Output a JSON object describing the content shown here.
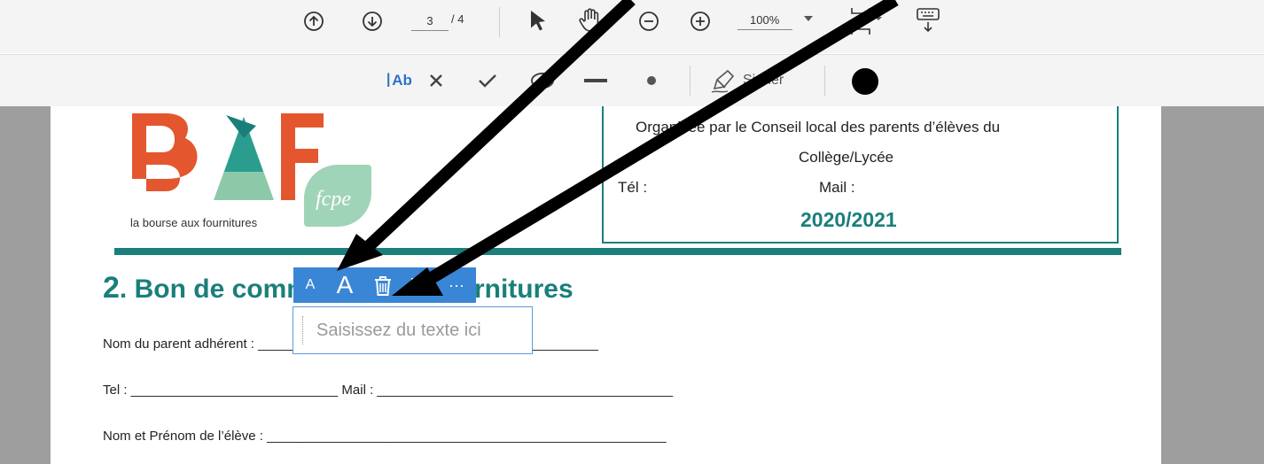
{
  "top_toolbar": {
    "current_page": "3",
    "page_total": "/ 4",
    "zoom": "100%"
  },
  "annotation_toolbar": {
    "text_tool_label": "Ab",
    "sign_label": "Signer",
    "color_swatch": "#000000"
  },
  "document": {
    "logo": {
      "tagline": "la bourse aux fournitures",
      "fcpe_text": "fcpe"
    },
    "organizer": {
      "line1": "Organisée par le Conseil local des parents d’élèves du",
      "line2": "Collège/Lycée",
      "tel_label": "Tél :",
      "mail_label": "Mail :",
      "year": "2020/2021"
    },
    "section": {
      "number": "2",
      "title": ". Bon de commande aux fournitures"
    },
    "fields": {
      "parent_name": "Nom du parent adhérent : ______________________________________________",
      "tel_mail": "Tel : ____________________________ Mail : ________________________________________",
      "student_name": "Nom et Prénom de l’élève : ______________________________________________________"
    }
  },
  "text_tool_popup": {
    "small_a": "A",
    "large_a": "A",
    "more": "···",
    "placeholder": "Saisissez du texte ici"
  },
  "colors": {
    "teal": "#1a7f7a",
    "logo_orange": "#e4572e",
    "fcpe_green": "#8cc9a8",
    "popup_blue": "#3a86d6"
  }
}
